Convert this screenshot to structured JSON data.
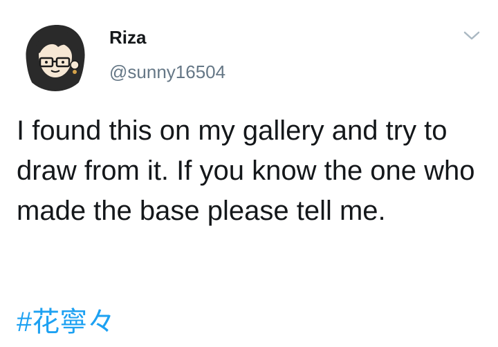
{
  "tweet": {
    "author": {
      "display_name": "Riza",
      "handle": "@sunny16504",
      "avatar_icon": "cartoon-avatar-with-glasses"
    },
    "menu_icon": "chevron-down-icon",
    "text": "I found this on my gallery and try to draw from it. If you know the one who made the base please tell me.",
    "hashtag": "#花寧々"
  },
  "colors": {
    "name": "#14171a",
    "handle": "#657786",
    "hashtag": "#1da1f2",
    "chevron": "#aab8c2"
  }
}
